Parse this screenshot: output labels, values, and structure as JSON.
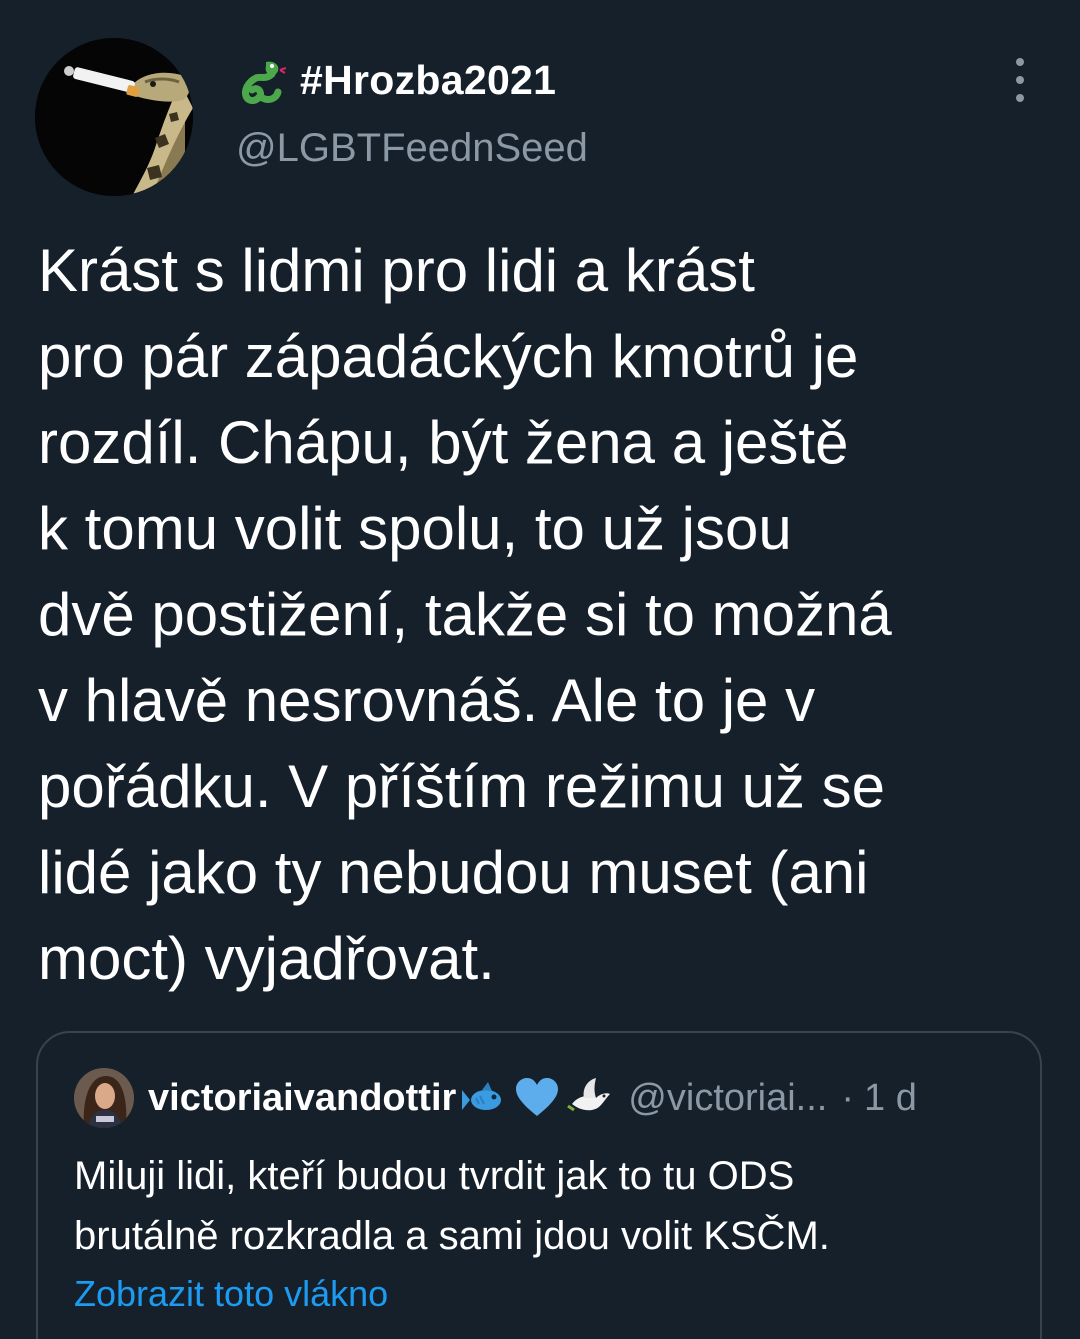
{
  "tweet": {
    "author": {
      "display_name": "#Hrozba2021",
      "handle": "@LGBTFeednSeed",
      "name_icon": "snake-icon",
      "avatar_icon": "snake-with-cigarette"
    },
    "text_lines": [
      "Krást s lidmi pro lidi a krást",
      "pro pár západáckých kmotrů je",
      "rozdíl. Chápu, být žena a ještě",
      "k tomu volit spolu, to už jsou",
      "dvě postižení, takže si to možná",
      "v hlavě nesrovnáš. Ale to je v",
      "pořádku. V příštím režimu už se",
      "lidé jako ty nebudou muset (ani",
      "moct) vyjadřovat."
    ]
  },
  "quote": {
    "display_name": "victoriaivandottir",
    "name_emojis": [
      "fish-icon",
      "blue-heart-icon",
      "dove-icon"
    ],
    "handle": "@victoriai...",
    "separator": "·",
    "time": "1 d",
    "text_lines": [
      "Miluji lidi, kteří budou tvrdit jak to tu ODS",
      "brutálně rozkradla a sami jdou volit KSČM."
    ],
    "thread_link": "Zobrazit toto vlákno"
  },
  "colors": {
    "background": "#15202b",
    "text": "#ffffff",
    "secondary_text": "#8b98a5",
    "link": "#1d9bf0",
    "border": "#38444d",
    "snake_green": "#4ca84a"
  }
}
